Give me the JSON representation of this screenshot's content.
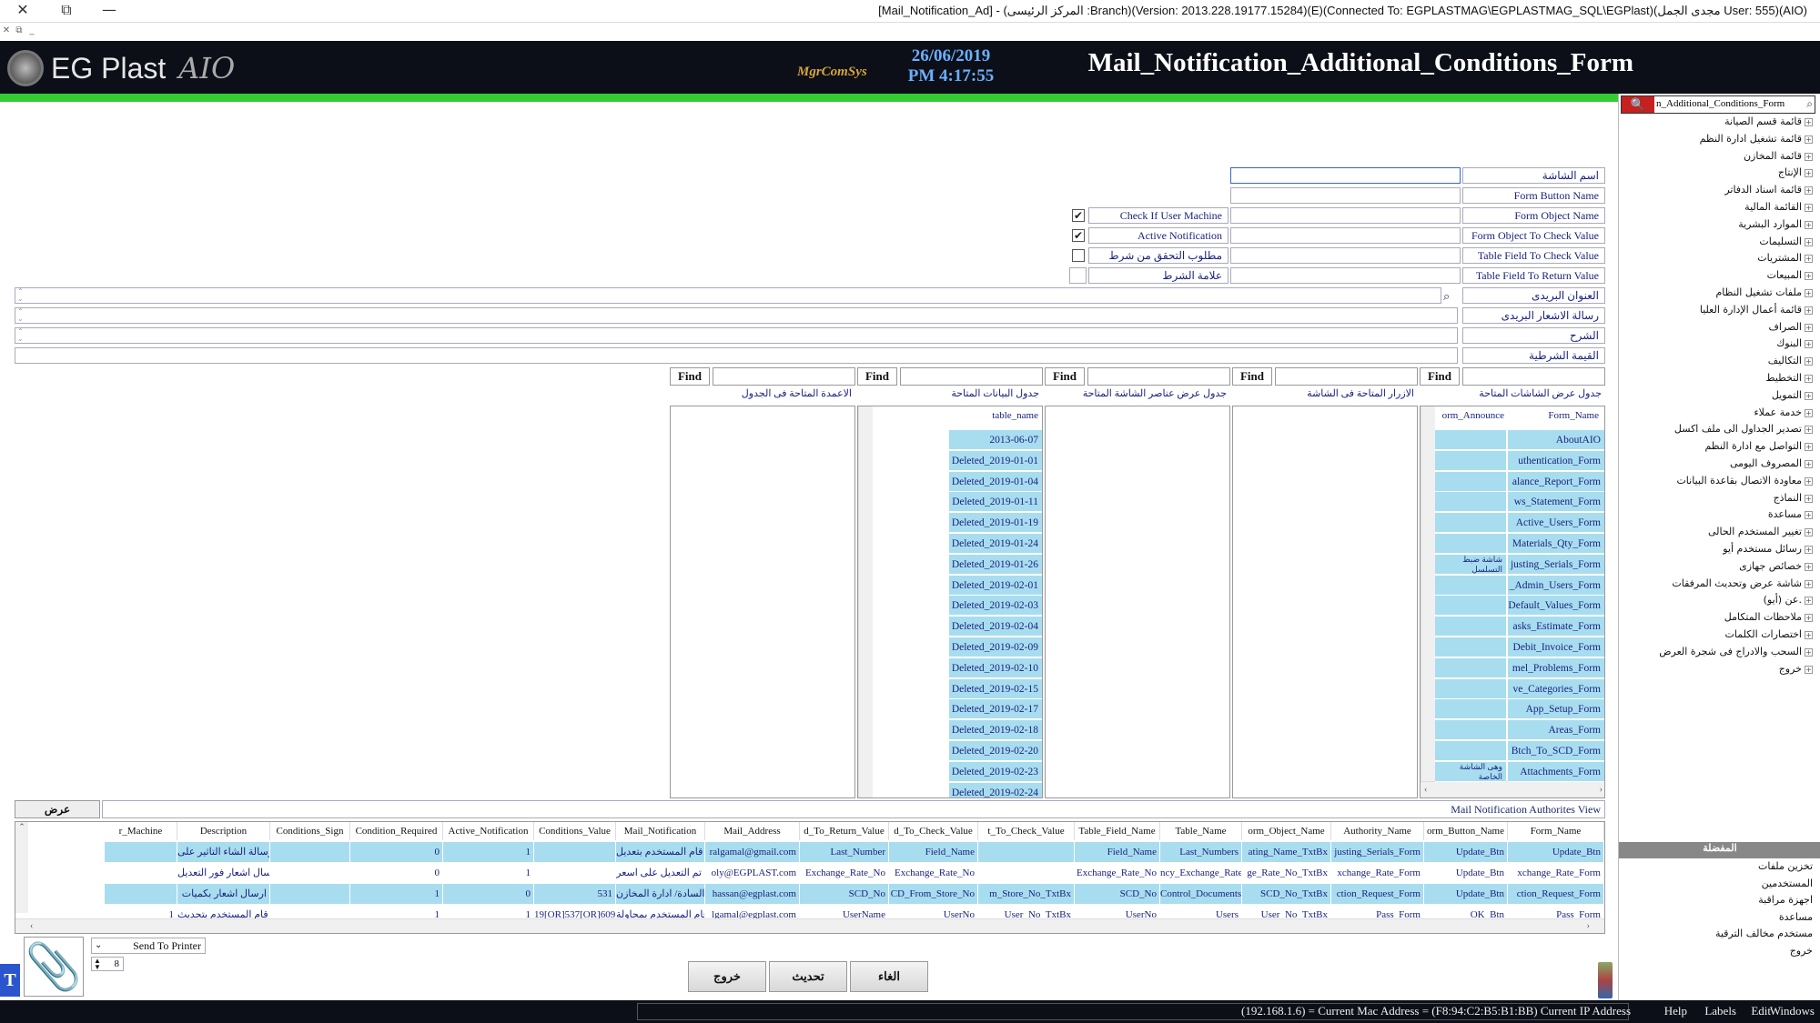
{
  "window": {
    "title": "[Mail_Notification_Ad] - (المركز الرئيسى :Branch)(Version: 2013.228.19177.15284)(E)(Connected To: EGPLASTMAG\\EGPLASTMAG_SQL\\EGPlast)(مجدى الجمل User: 555)(AIO)",
    "close": "✕",
    "restore": "⧉",
    "minimize": "—"
  },
  "header": {
    "brand": "EG Plast",
    "brand_suffix": "AIO",
    "mgr": "MgrComSys",
    "date": "26/06/2019",
    "time": "PM 4:17:55",
    "form_title": "Mail_Notification_Additional_Conditions_Form"
  },
  "side": {
    "search_text": "n_Additional_Conditions_Form",
    "items": [
      "قائمة قسم الصيانة",
      "قائمة تشغيل ادارة النظم",
      "قائمة المخازن",
      "الإنتاج",
      "قائمة اسناد الدفاتر",
      "القائمة المالية",
      "الموارد البشرية",
      "التسليمات",
      "المشتريات",
      "المبيعات",
      "ملفات تشغيل النظام",
      "قائمة أعمال الإدارة العليا",
      "الصراف",
      "البنوك",
      "التكاليف",
      "التخطيط",
      "التمويل",
      "خدمة عملاء",
      "تصدير الجداول الى ملف اكسل",
      "التواصل مع ادارة النظم",
      "المصروف اليومى",
      "معاودة الاتصال بقاعدة البيانات",
      "النماذج",
      "مساعدة",
      "تغيير المستخدم الحالى",
      "رسائل مستخدم أيو",
      "خصائص جهازى",
      "شاشة عرض وتحديث المرفقات",
      "عن (أيو).",
      "ملاحظات المتكامل",
      "اختصارات الكلمات",
      "السحب والادراج فى شجرة العرض",
      "خروج"
    ],
    "panel_header": "المفضلة",
    "fav_items": [
      "تخزين ملفات",
      "المستخدمين",
      "اجهزة مراقبة",
      "مساعدة",
      "مستخدم مخالف الترقية",
      "خروج"
    ]
  },
  "form": {
    "screen_name": "اسم الشاشة",
    "form_button_name": "Form Button Name",
    "form_object_name": "Form Object Name",
    "form_object_check": "Form Object To Check Value",
    "table_field_check": "Table Field To Check Value",
    "table_field_return": "Table Field To Return Value",
    "check_user_machine": "Check If User Machine",
    "active_notification": "Active Notification",
    "condition_required": "مطلوب التحقق من شرط",
    "condition_sign": "علامة الشرط",
    "mail_address": "العنوان البريدى",
    "notification_message": "رسالة الاشعار البريدى",
    "description": "الشرح",
    "condition_value": "القيمة الشرطية",
    "checked": "☑",
    "check_mark": "✔"
  },
  "lists": {
    "find": "Find",
    "forms_title": "جدول عرض الشاشات المتاحة",
    "buttons_title": "الازرار المتاحة فى الشاشة",
    "elements_title": "جدول عرض عناصر الشاشة المتاحة",
    "tables_title": "جدول البيانات المتاحة",
    "columns_title": "الاعمدة المتاحة فى الجدول",
    "forms_col1": "Form_Name",
    "forms_col2": "orm_Announce",
    "forms": [
      "AboutAIO",
      "uthentication_Form",
      "alance_Report_Form",
      "ws_Statement_Form",
      "Active_Users_Form",
      "Materials_Qty_Form",
      "justing_Serials_Form",
      "_Admin_Users_Form",
      "Default_Values_Form",
      "asks_Estimate_Form",
      "Debit_Invoice_Form",
      "mel_Problems_Form",
      "ve_Categories_Form",
      "App_Setup_Form",
      "Areas_Form",
      "Btch_To_SCD_Form",
      "Attachments_Form"
    ],
    "forms_announce_a": "شاشة ضبط التسلسل",
    "forms_announce_b": "وهى الشاشة الخاصة",
    "tables_col": "table_name",
    "tables": [
      "2013-06-07",
      "Deleted_2019-01-01",
      "Deleted_2019-01-04",
      "Deleted_2019-01-11",
      "Deleted_2019-01-19",
      "Deleted_2019-01-24",
      "Deleted_2019-01-26",
      "Deleted_2019-02-01",
      "Deleted_2019-02-03",
      "Deleted_2019-02-04",
      "Deleted_2019-02-09",
      "Deleted_2019-02-10",
      "Deleted_2019-02-15",
      "Deleted_2019-02-17",
      "Deleted_2019-02-18",
      "Deleted_2019-02-20",
      "Deleted_2019-02-23",
      "Deleted_2019-02-24"
    ]
  },
  "grid": {
    "view_button": "عرض",
    "view_title": "Mail Notification Authorites View",
    "columns": [
      "Form_Name",
      "orm_Button_Name",
      "Authority_Name",
      "orm_Object_Name",
      "Table_Name",
      "Table_Field_Name",
      "t_To_Check_Value",
      "d_To_Check_Value",
      "d_To_Return_Value",
      "Mail_Address",
      "Mail_Notification",
      "Conditions_Value",
      "Active_Notification",
      "Condition_Required",
      "Conditions_Sign",
      "Description",
      "r_Machine"
    ],
    "rows": [
      [
        "Update_Btn",
        "Update_Btn",
        "justing_Serials_Form",
        "ating_Name_TxtBx",
        "Last_Numbers",
        "Field_Name",
        "",
        "Field_Name",
        "Last_Number",
        "ralgamal@gmail.com",
        "لقد قام المستخدم بتعديل",
        "",
        "1",
        "0",
        "",
        "رسالة الشاء التاثير على",
        ""
      ],
      [
        "xchange_Rate_Form",
        "Update_Btn",
        "xchange_Rate_Form",
        "ge_Rate_No_TxtBx",
        "ncy_Exchange_Rate",
        "Exchange_Rate_No",
        "",
        "Exchange_Rate_No",
        "Exchange_Rate_No",
        "oly@EGPLAST.com",
        "تم التعديل على اسعر",
        "",
        "1",
        "0",
        "",
        "ارسال اشعار فور التعديل",
        ""
      ],
      [
        "ction_Request_Form",
        "Update_Btn",
        "ction_Request_Form",
        "SCD_No_TxtBx",
        "Control_Documents",
        "SCD_No",
        "m_Store_No_TxtBx",
        "CD_From_Store_No",
        "SCD_No",
        "hassan@egplast.com",
        "السادة/ ادارة المخازن",
        "531",
        "0",
        "1",
        "",
        "ارسال اشعار بكميات",
        ""
      ],
      [
        "Pass_Form",
        "OK_Btn",
        "Pass_Form",
        "User_No_TxtBx",
        "Users",
        "UserNo",
        "User_No_TxtBx",
        "UserNo",
        "UserName",
        "lgamal@egplast.com",
        "قام المستخدم بمحاولة",
        "19[OR]537[OR]609",
        "1",
        "1",
        "",
        "لقد قام المستخدم بتحديث",
        "1"
      ]
    ]
  },
  "printer": {
    "label": "Send To Printer",
    "copies": "8"
  },
  "buttons": {
    "exit": "خروج",
    "update": "تحديث",
    "cancel": "الغاء"
  },
  "status": {
    "ip_info": "(192.168.1.6) = Current Mac Address = (F8:94:C2:B5:B1:BB) Current IP Address",
    "help": "Help",
    "labels": "Labels",
    "edit": "Edit",
    "windows": "Windows"
  }
}
